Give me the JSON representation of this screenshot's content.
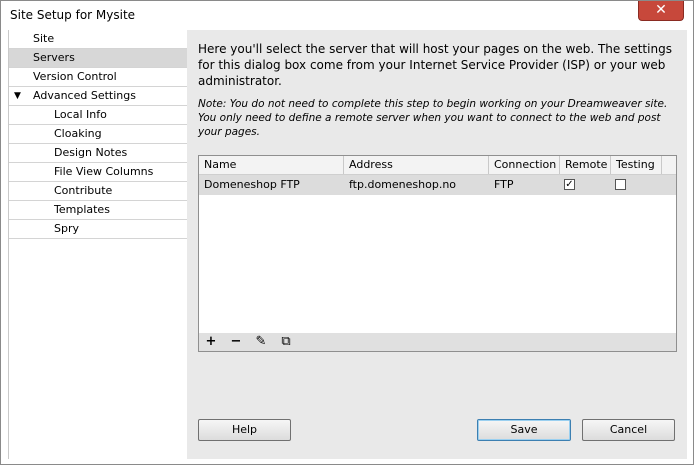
{
  "window": {
    "title": "Site Setup for Mysite",
    "close_glyph": "✕"
  },
  "sidebar": {
    "items": [
      {
        "label": "Site"
      },
      {
        "label": "Servers"
      },
      {
        "label": "Version Control"
      },
      {
        "label": "Advanced Settings"
      },
      {
        "label": "Local Info"
      },
      {
        "label": "Cloaking"
      },
      {
        "label": "Design Notes"
      },
      {
        "label": "File View Columns"
      },
      {
        "label": "Contribute"
      },
      {
        "label": "Templates"
      },
      {
        "label": "Spry"
      }
    ],
    "expand_glyph": "▼"
  },
  "main": {
    "intro": "Here you'll select the server that will host your pages on the web. The settings for this dialog box come from your Internet Service Provider (ISP) or your web administrator.",
    "note": "Note: You do not need to complete this step to begin working on your Dreamweaver site. You only need to define a remote server when you want to connect to the web and post your pages."
  },
  "servers_table": {
    "columns": [
      "Name",
      "Address",
      "Connection",
      "Remote",
      "Testing"
    ],
    "rows": [
      {
        "name": "Domeneshop FTP",
        "address": "ftp.domeneshop.no",
        "connection": "FTP",
        "remote_mark": "✓",
        "testing_mark": ""
      }
    ]
  },
  "toolbar": {
    "add_glyph": "+",
    "remove_glyph": "−",
    "edit_glyph": "✎",
    "duplicate_glyph": "⧉"
  },
  "buttons": {
    "help": "Help",
    "save": "Save",
    "cancel": "Cancel"
  }
}
